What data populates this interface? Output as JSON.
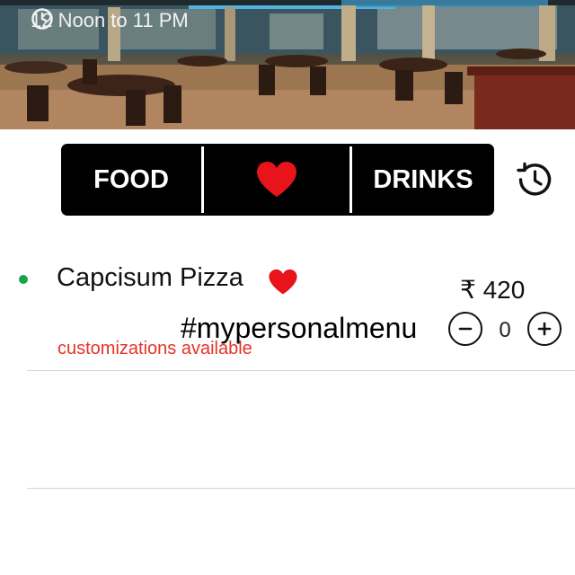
{
  "header": {
    "hours": "12 Noon to 11 PM"
  },
  "tabs": {
    "food": "FOOD",
    "drinks": "DRINKS"
  },
  "icons": {
    "hours": "clock-icon",
    "favorites": "heart-icon",
    "history": "history-icon",
    "decrement": "minus-icon",
    "increment": "plus-icon"
  },
  "colors": {
    "tab_bar": "#000000",
    "heart": "#e8141c",
    "veg_dot": "#18a24a",
    "customizations": "#e53324"
  },
  "menu": {
    "items": [
      {
        "name": "Capcisum Pizza",
        "price": "₹ 420",
        "tag": "#mypersonalmenu",
        "note": "customizations available",
        "quantity": "0"
      }
    ]
  }
}
